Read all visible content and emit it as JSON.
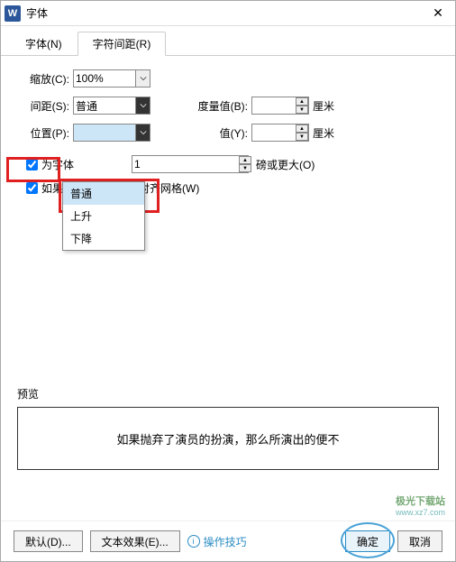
{
  "title": "字体",
  "tabs": {
    "font": "字体(N)",
    "spacing": "字符间距(R)"
  },
  "labels": {
    "scale": "缩放(C):",
    "spacing": "间距(S):",
    "position": "位置(P):",
    "measure": "度量值(B):",
    "value": "值(Y):",
    "unit_cm": "厘米",
    "points_or_more": "磅或更大(O)"
  },
  "values": {
    "scale": "100%",
    "spacing": "普通",
    "position": "",
    "measure": "",
    "value_y": "",
    "kerning": "1"
  },
  "dropdown": {
    "opt1": "普通",
    "opt2": "上升",
    "opt3": "下降"
  },
  "checks": {
    "kerning": "为字体",
    "snap": "如果定",
    "snap_suffix": "则对齐网格(W)"
  },
  "preview": {
    "label": "预览",
    "text": "如果抛弃了演员的扮演，那么所演出的便不"
  },
  "footer": {
    "default": "默认(D)...",
    "effects": "文本效果(E)...",
    "tips": "操作技巧",
    "ok": "确定",
    "cancel": "取消"
  },
  "watermark": {
    "line1": "极光下载站",
    "line2": "www.xz7.com"
  }
}
